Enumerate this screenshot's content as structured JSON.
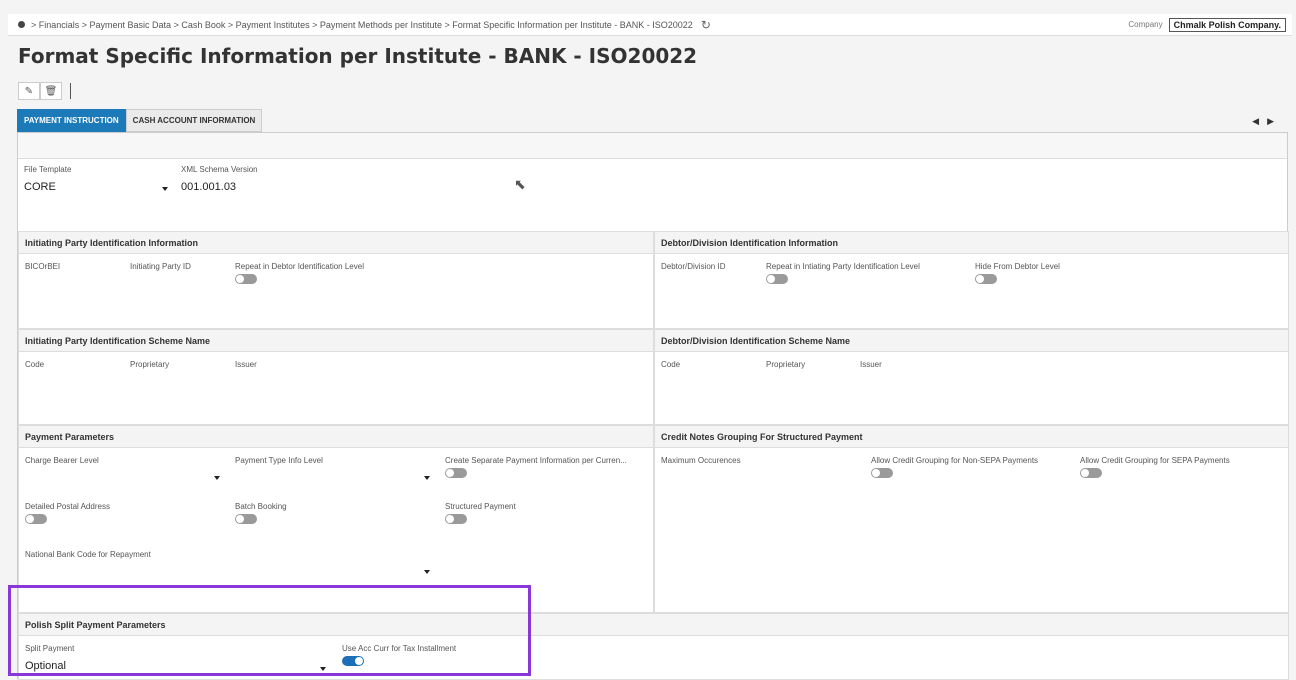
{
  "breadcrumb": "> Financials > Payment Basic Data > Cash Book > Payment Institutes > Payment Methods per Institute > Format Specific Information per Institute - BANK - ISO20022",
  "company": {
    "label": "Company",
    "value": "Chmalk Polish Company."
  },
  "page_title": "Format Specific Information per Institute - BANK - ISO20022",
  "tabs": [
    {
      "label": "PAYMENT INSTRUCTION"
    },
    {
      "label": "CASH ACCOUNT INFORMATION"
    }
  ],
  "top": {
    "file_template_label": "File Template",
    "file_template_value": "CORE",
    "xml_schema_label": "XML Schema Version",
    "xml_schema_value": "001.001.03"
  },
  "initiating_party": {
    "title": "Initiating Party Identification Information",
    "bicorbei": "BICOrBEI",
    "initiating_party_id": "Initiating Party ID",
    "repeat_debtor": "Repeat in Debtor Identification Level"
  },
  "debtor_division": {
    "title": "Debtor/Division Identification Information",
    "id": "Debtor/Division ID",
    "repeat_initiating": "Repeat in Intiating Party Identification Level",
    "hide_from_debtor": "Hide From Debtor Level"
  },
  "initiating_scheme": {
    "title": "Initiating Party Identification Scheme Name",
    "code": "Code",
    "proprietary": "Proprietary",
    "issuer": "Issuer"
  },
  "debtor_scheme": {
    "title": "Debtor/Division Identification Scheme Name",
    "code": "Code",
    "proprietary": "Proprietary",
    "issuer": "Issuer"
  },
  "payment_params": {
    "title": "Payment Parameters",
    "charge_bearer": "Charge Bearer Level",
    "payment_type_info": "Payment Type Info Level",
    "create_separate": "Create Separate Payment Information per Curren...",
    "detailed_postal": "Detailed Postal Address",
    "batch_booking": "Batch Booking",
    "structured_payment": "Structured Payment",
    "national_bank_code": "National Bank Code for Repayment"
  },
  "credit_notes": {
    "title": "Credit Notes Grouping For Structured Payment",
    "max_occurences": "Maximum Occurences",
    "allow_non_sepa": "Allow Credit Grouping for Non-SEPA Payments",
    "allow_sepa": "Allow Credit Grouping for SEPA Payments"
  },
  "polish_split": {
    "title": "Polish Split Payment Parameters",
    "split_payment_label": "Split Payment",
    "split_payment_value": "Optional",
    "use_acc_curr": "Use Acc Curr for Tax Installment",
    "use_acc_curr_on": true
  }
}
